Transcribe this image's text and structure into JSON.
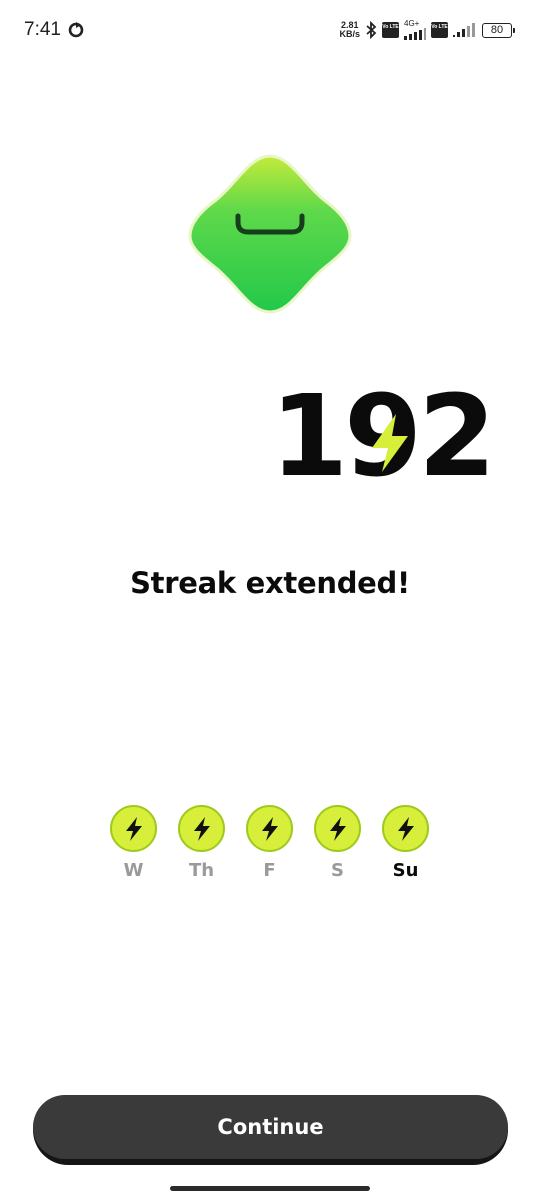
{
  "status_bar": {
    "time": "7:41",
    "speed_value": "2.81",
    "speed_unit": "KB/s",
    "sim1_volte": "Vo LTE",
    "sim1_network": "4G+",
    "sim2_volte": "Vo LTE",
    "battery": "80",
    "icons": [
      "sync-icon",
      "bluetooth-icon",
      "signal-icon",
      "battery-icon"
    ]
  },
  "streak": {
    "count": "192",
    "headline": "Streak extended!"
  },
  "week": {
    "days": [
      {
        "label": "W",
        "completed": true,
        "current": false
      },
      {
        "label": "Th",
        "completed": true,
        "current": false
      },
      {
        "label": "F",
        "completed": true,
        "current": false
      },
      {
        "label": "S",
        "completed": true,
        "current": false
      },
      {
        "label": "Su",
        "completed": true,
        "current": true
      }
    ]
  },
  "actions": {
    "continue_label": "Continue"
  },
  "colors": {
    "bolt": "#d7ef3a",
    "mascot_top": "#c4ea3a",
    "mascot_bottom": "#25c94a",
    "button": "#3a3a3a"
  }
}
